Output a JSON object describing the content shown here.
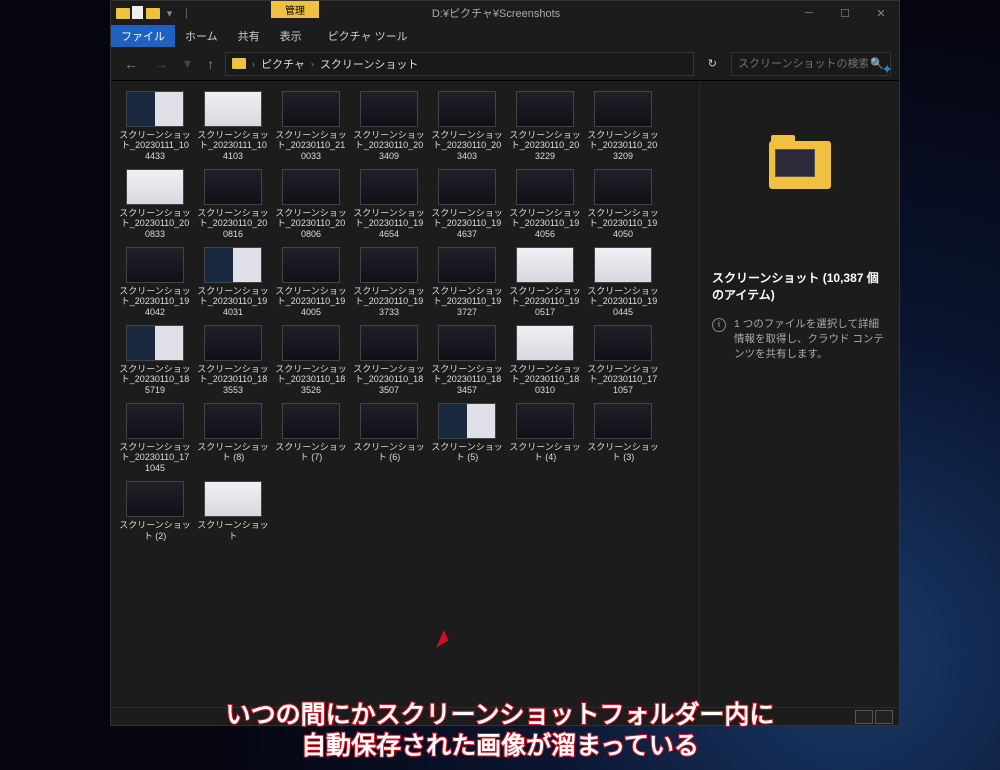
{
  "titlebar": {
    "context_tab": "管理",
    "path_title": "D:¥ピクチャ¥Screenshots"
  },
  "menubar": {
    "file": "ファイル",
    "home": "ホーム",
    "share": "共有",
    "view": "表示",
    "picture_tools": "ピクチャ ツール"
  },
  "breadcrumbs": {
    "root": "ピクチャ",
    "current": "スクリーンショット"
  },
  "search": {
    "placeholder": "スクリーンショットの検索"
  },
  "details": {
    "title": "スクリーンショット (10,387 個のアイテム)",
    "hint": "1 つのファイルを選択して詳細情報を取得し、クラウド コンテンツを共有します。"
  },
  "files": [
    {
      "label": "スクリーンショット_20230111_104433",
      "t": "mixed"
    },
    {
      "label": "スクリーンショット_20230111_104103",
      "t": "light"
    },
    {
      "label": "スクリーンショット_20230110_210033",
      "t": "dark"
    },
    {
      "label": "スクリーンショット_20230110_203409",
      "t": "dark"
    },
    {
      "label": "スクリーンショット_20230110_203403",
      "t": "dark"
    },
    {
      "label": "スクリーンショット_20230110_203229",
      "t": "dark"
    },
    {
      "label": "スクリーンショット_20230110_203209",
      "t": "dark"
    },
    {
      "label": "スクリーンショット_20230110_200833",
      "t": "light"
    },
    {
      "label": "スクリーンショット_20230110_200816",
      "t": "dark"
    },
    {
      "label": "スクリーンショット_20230110_200806",
      "t": "dark"
    },
    {
      "label": "スクリーンショット_20230110_194654",
      "t": "dark"
    },
    {
      "label": "スクリーンショット_20230110_194637",
      "t": "dark"
    },
    {
      "label": "スクリーンショット_20230110_194056",
      "t": "dark"
    },
    {
      "label": "スクリーンショット_20230110_194050",
      "t": "dark"
    },
    {
      "label": "スクリーンショット_20230110_194042",
      "t": "dark"
    },
    {
      "label": "スクリーンショット_20230110_194031",
      "t": "mixed"
    },
    {
      "label": "スクリーンショット_20230110_194005",
      "t": "dark"
    },
    {
      "label": "スクリーンショット_20230110_193733",
      "t": "dark"
    },
    {
      "label": "スクリーンショット_20230110_193727",
      "t": "dark"
    },
    {
      "label": "スクリーンショット_20230110_190517",
      "t": "light"
    },
    {
      "label": "スクリーンショット_20230110_190445",
      "t": "light"
    },
    {
      "label": "スクリーンショット_20230110_185719",
      "t": "mixed"
    },
    {
      "label": "スクリーンショット_20230110_183553",
      "t": "dark"
    },
    {
      "label": "スクリーンショット_20230110_183526",
      "t": "dark"
    },
    {
      "label": "スクリーンショット_20230110_183507",
      "t": "dark"
    },
    {
      "label": "スクリーンショット_20230110_183457",
      "t": "dark"
    },
    {
      "label": "スクリーンショット_20230110_180310",
      "t": "light"
    },
    {
      "label": "スクリーンショット_20230110_171057",
      "t": "dark"
    },
    {
      "label": "スクリーンショット_20230110_171045",
      "t": "dark"
    },
    {
      "label": "スクリーンショット (8)",
      "t": "dark"
    },
    {
      "label": "スクリーンショット (7)",
      "t": "dark"
    },
    {
      "label": "スクリーンショット (6)",
      "t": "dark"
    },
    {
      "label": "スクリーンショット (5)",
      "t": "mixed"
    },
    {
      "label": "スクリーンショット (4)",
      "t": "dark"
    },
    {
      "label": "スクリーンショット (3)",
      "t": "dark"
    },
    {
      "label": "スクリーンショット (2)",
      "t": "dark"
    },
    {
      "label": "スクリーンショット",
      "t": "light"
    }
  ],
  "caption": {
    "line1": "いつの間にかスクリーンショットフォルダー内に",
    "line2": "自動保存された画像が溜まっている"
  }
}
